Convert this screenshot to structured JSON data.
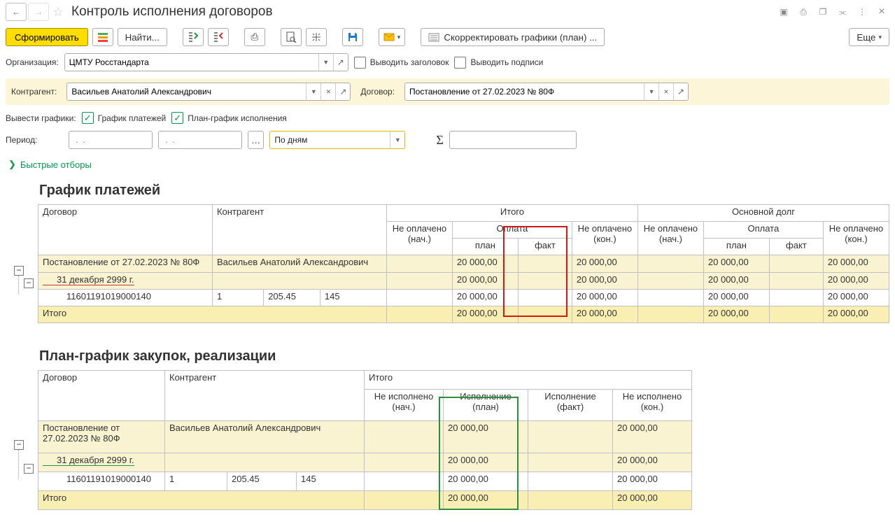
{
  "header": {
    "title": "Контроль исполнения договоров"
  },
  "toolbar": {
    "generate": "Сформировать",
    "find": "Найти...",
    "adjust": "Скорректировать графики (план) ...",
    "more": "Еще"
  },
  "filters": {
    "org_label": "Организация:",
    "org_value": "ЦМТУ Росстандарта",
    "show_header": "Выводить заголовок",
    "show_signs": "Выводить подписи",
    "agent_label": "Контрагент:",
    "agent_value": "Васильев Анатолий Александрович",
    "contract_label": "Договор:",
    "contract_value": "Постановление от 27.02.2023 № 80Ф",
    "charts_label": "Вывести графики:",
    "pay_schedule": "График платежей",
    "exec_schedule": "План-график исполнения",
    "period_label": "Период:",
    "step_value": "По дням",
    "date_placeholder": " .  .  "
  },
  "quick_filters": "Быстрые отборы",
  "section1": {
    "title": "График платежей",
    "h_contract": "Договор",
    "h_agent": "Контрагент",
    "h_total": "Итого",
    "h_principal": "Основной долг",
    "h_unpaid_start": "Не оплачено (нач.)",
    "h_payment": "Оплата",
    "h_plan": "план",
    "h_fact": "факт",
    "h_unpaid_end": "Не оплачено (кон.)",
    "rows": [
      {
        "contract": "Постановление от 27.02.2023 № 80Ф",
        "agent": "Васильев Анатолий Александрович",
        "plan": "20 000,00",
        "unpaid_end": "20 000,00",
        "plan2": "20 000,00",
        "unpaid_end2": "20 000,00"
      },
      {
        "contract": "31 декабря 2999 г.",
        "plan": "20 000,00",
        "unpaid_end": "20 000,00",
        "plan2": "20 000,00",
        "unpaid_end2": "20 000,00"
      },
      {
        "contract": "11601191019000140",
        "a1": "1",
        "a2": "205.45",
        "a3": "145",
        "plan": "20 000,00",
        "unpaid_end": "20 000,00",
        "plan2": "20 000,00",
        "unpaid_end2": "20 000,00"
      }
    ],
    "total_label": "Итого",
    "totals": {
      "plan": "20 000,00",
      "unpaid_end": "20 000,00",
      "plan2": "20 000,00",
      "unpaid_end2": "20 000,00"
    }
  },
  "section2": {
    "title": "План-график закупок, реализации",
    "h_contract": "Договор",
    "h_agent": "Контрагент",
    "h_total": "Итого",
    "h_unexec_start": "Не исполнено (нач.)",
    "h_exec_plan": "Исполнение (план)",
    "h_exec_fact": "Исполнение (факт)",
    "h_unexec_end": "Не исполнено (кон.)",
    "rows": [
      {
        "contract": "Постановление от 27.02.2023 № 80Ф",
        "agent": "Васильев Анатолий Александрович",
        "plan": "20 000,00",
        "unexec_end": "20 000,00"
      },
      {
        "contract": "31 декабря 2999 г.",
        "plan": "20 000,00",
        "unexec_end": "20 000,00"
      },
      {
        "contract": "11601191019000140",
        "a1": "1",
        "a2": "205.45",
        "a3": "145",
        "plan": "20 000,00",
        "unexec_end": "20 000,00"
      }
    ],
    "total_label": "Итого",
    "totals": {
      "plan": "20 000,00",
      "unexec_end": "20 000,00"
    }
  }
}
